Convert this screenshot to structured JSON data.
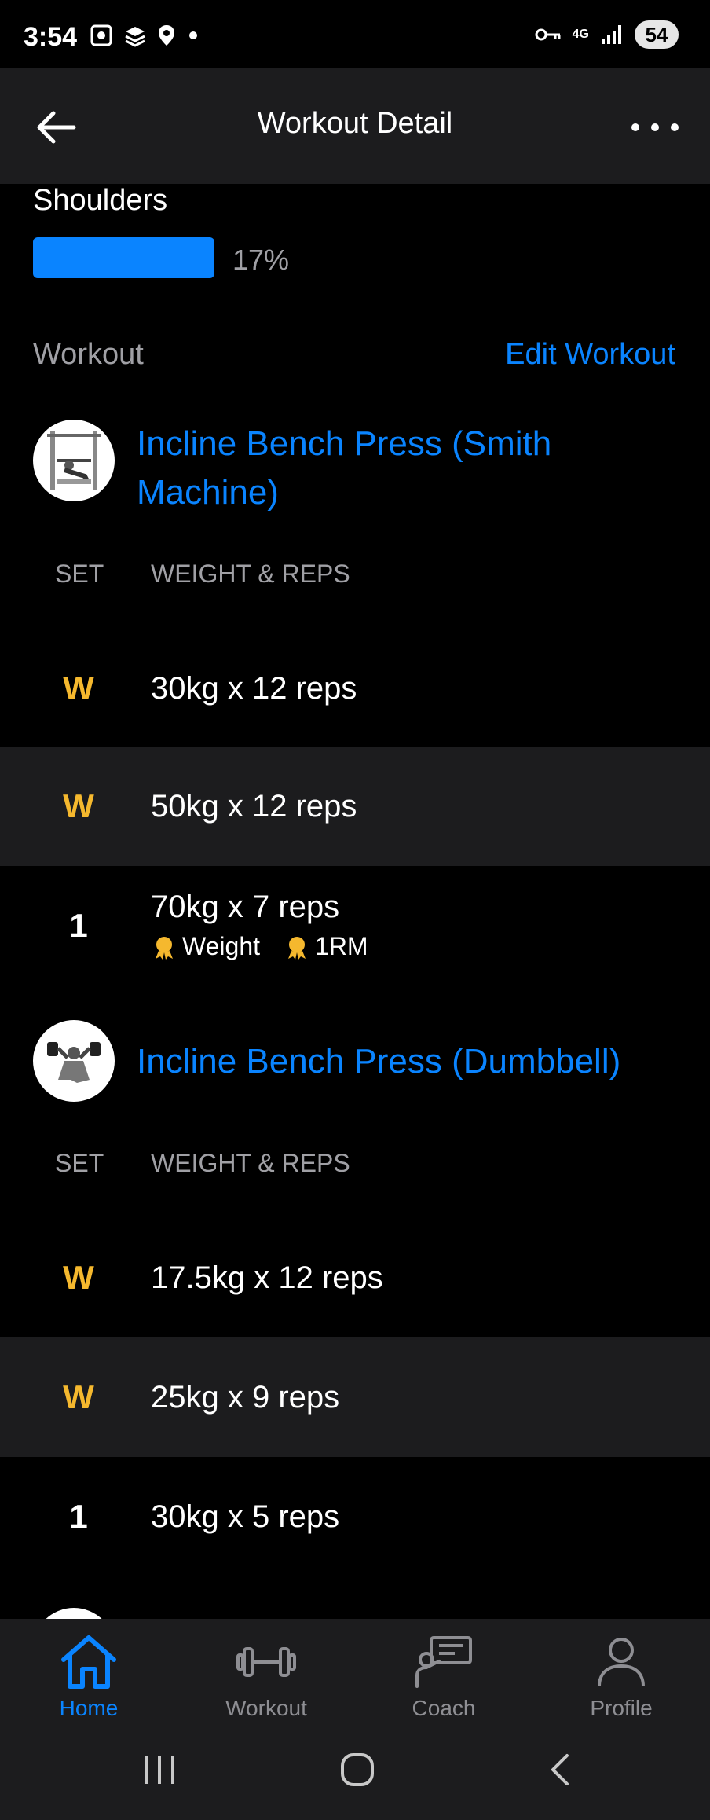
{
  "status": {
    "time": "3:54",
    "network": "4G",
    "battery": "54"
  },
  "header": {
    "title": "Workout Detail"
  },
  "muscle": {
    "name": "Shoulders",
    "percent_label": "17%",
    "percent": 17
  },
  "workout": {
    "section_label": "Workout",
    "edit_label": "Edit Workout",
    "exercises": [
      {
        "name": "Incline Bench Press (Smith Machine)",
        "col_set": "SET",
        "col_weight": "WEIGHT & REPS",
        "sets": [
          {
            "set": "W",
            "detail": "30kg x 12 reps"
          },
          {
            "set": "W",
            "detail": "50kg x 12 reps"
          },
          {
            "set": "1",
            "detail": "70kg x 7 reps",
            "badges": [
              "Weight",
              "1RM"
            ]
          }
        ]
      },
      {
        "name": "Incline Bench Press (Dumbbell)",
        "col_set": "SET",
        "col_weight": "WEIGHT & REPS",
        "sets": [
          {
            "set": "W",
            "detail": "17.5kg x 12 reps"
          },
          {
            "set": "W",
            "detail": "25kg x 9 reps"
          },
          {
            "set": "1",
            "detail": "30kg x 5 reps"
          }
        ]
      }
    ]
  },
  "nav": {
    "items": [
      {
        "label": "Home",
        "icon": "home-icon"
      },
      {
        "label": "Workout",
        "icon": "dumbbell-icon"
      },
      {
        "label": "Coach",
        "icon": "coach-icon"
      },
      {
        "label": "Profile",
        "icon": "profile-icon"
      }
    ],
    "active": "Home"
  },
  "colors": {
    "accent": "#0a84ff",
    "warmup": "#f5b82e",
    "badge": "#f5b82e"
  }
}
